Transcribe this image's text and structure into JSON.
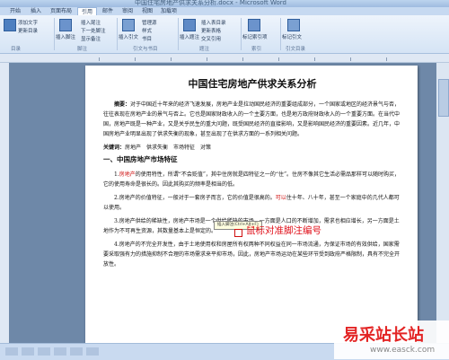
{
  "window": {
    "title": "中国住宅房地产供求关系分析.docx - Microsoft Word"
  },
  "tabs": [
    "开始",
    "插入",
    "页面布局",
    "引用",
    "邮件",
    "审阅",
    "视图",
    "加载项"
  ],
  "ribbon": {
    "groups": [
      "目录",
      "脚注",
      "引文与书目",
      "题注",
      "索引",
      "引文目录"
    ],
    "items": [
      "添加文字",
      "更新目录",
      "插入脚注",
      "插入尾注",
      "下一处脚注",
      "显示备注",
      "插入引文",
      "管理源",
      "样式",
      "书目",
      "插入题注",
      "插入表目录",
      "更新表格",
      "交叉引用",
      "标记索引项",
      "标记引文"
    ]
  },
  "document": {
    "title": "中国住宅房地产供求关系分析",
    "abstract_label": "摘要：",
    "abstract": "对于中国近十年来的经济飞速发展，房地产业是拉动国民经济的重要组成部分，一个国家或地区的经济景气与否，往往表现在房地产业的景气与否上。它也是国家财政收入的一个主要方面，也是地方政府财政收入的一个重要方面。在当代中国，房地产既是一种产业，又是关乎民生的重大问题，既受国民经济的直接影响，又是影响国民经济的重要因素。近几年，中国房地产业明显出现了供求失衡的现象，甚至出现了在供求方面的一系列相关问题。",
    "keywords_label": "关键词：",
    "keywords": "房地产　供求失衡　市场特征　对策",
    "heading1": "一、中国房地产市场特征",
    "p1_prefix": "1.",
    "p1_red": "房地产",
    "p1_rest": "的使用特性，所谓“不会贬值”，其中住房就是四特征之一的“住”。住房不像其它生活必需品那样可以随时购买，它的使用寿命是很长的。因此其购买的频率是相当的低。",
    "p2_prefix": "2.房地产的价值特征，一般对于一套房子而言，它的价值是很高的。",
    "p2_red": "可以",
    "p2_rest": "住十年、八十年，甚至一个家庭中的几代人都可以使用。",
    "p3": "3.房地产供给的稀缺性，房地产市场是一个供给稀缺的市场，一方面是人口的不断增加，需求也相应增长，另一方面是土地作为不可再生资源，其数量基本上是恒定的。",
    "p4": "4.房地产的不完全开发性，由于土地使用权和房屋所有权两种不同权益在同一市场流通，为保证市场的有效供给，国家需要采取强有力的措施抑制不合理的市场需求来平抑市场，因此，房地产市场运动在某些环节受到政府严格限制，具有不完全开放性。"
  },
  "overlay": {
    "tooltip": "插入脚注(Ctrl+Alt+F)",
    "caption": "鼠标对准脚注编号"
  },
  "watermark": {
    "text": "易采站长站",
    "url": "www.easck.com"
  }
}
